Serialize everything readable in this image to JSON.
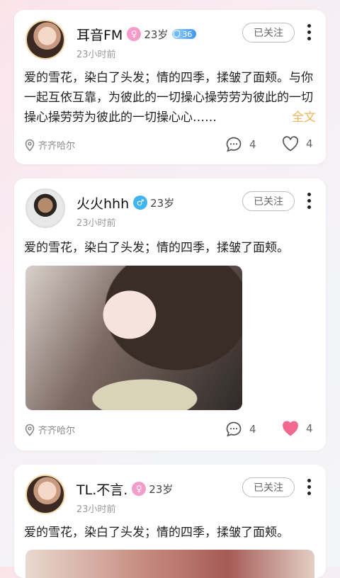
{
  "posts": [
    {
      "name": "耳音FM",
      "gender_icon": "female-icon",
      "age": "23岁",
      "level": "36",
      "time": "23小时前",
      "follow_label": "已关注",
      "text": "爱的雪花，染白了头发；情的四季，揉皱了面颊。与你一起互依互靠，为彼此的一切操心操劳劳为彼此的一切操心操劳劳为彼此的一切操心心……",
      "full_text_label": "全文",
      "location": "齐齐哈尔",
      "comments": "4",
      "likes": "4",
      "liked": false
    },
    {
      "name": "火火hhh",
      "gender_icon": "male-icon",
      "age": "23岁",
      "time": "23小时前",
      "follow_label": "已关注",
      "text": "爱的雪花，染白了头发；情的四季，揉皱了面颊。",
      "location": "齐齐哈尔",
      "comments": "4",
      "likes": "4",
      "liked": true
    },
    {
      "name": "TL.不言.",
      "gender_icon": "female-icon",
      "age": "23岁",
      "time": "23小时前",
      "follow_label": "已关注",
      "text": "爱的雪花，染白了头发；情的四季，揉皱了面颊。"
    }
  ],
  "colors": {
    "female": "#f59cc8",
    "male": "#3fb4ee",
    "liked": "#f2688f",
    "full_text": "#f1b25a"
  }
}
